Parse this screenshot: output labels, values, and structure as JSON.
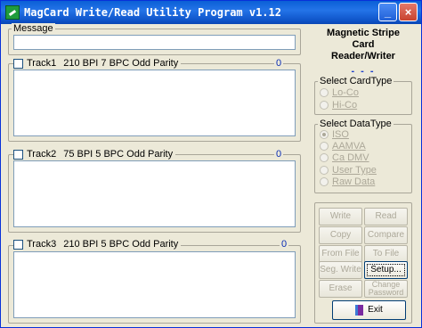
{
  "window": {
    "title": "MagCard Write/Read Utility Program v1.12",
    "minimize": "_",
    "maximize": "□",
    "close": "×"
  },
  "message": {
    "label": "Message",
    "value": ""
  },
  "tracks": [
    {
      "label": "Track1",
      "info": "210 BPI  7 BPC  Odd Parity",
      "count": "0",
      "data": ""
    },
    {
      "label": "Track2",
      "info": "75 BPI  5 BPC  Odd Parity",
      "count": "0",
      "data": ""
    },
    {
      "label": "Track3",
      "info": "210 BPI  5 BPC  Odd Parity",
      "count": "0",
      "data": ""
    }
  ],
  "brand": {
    "line1": "Magnetic Stripe Card",
    "line2": "Reader/Writer",
    "status": "- - -"
  },
  "card_type": {
    "title": "Select CardType",
    "options": [
      "Lo-Co",
      "Hi-Co"
    ]
  },
  "data_type": {
    "title": "Select DataType",
    "options": [
      "ISO",
      "AAMVA",
      "Ca DMV",
      "User Type",
      "Raw Data"
    ],
    "selected": "ISO"
  },
  "buttons": {
    "write": "Write",
    "read": "Read",
    "copy": "Copy",
    "compare": "Compare",
    "from_file": "From File",
    "to_file": "To File",
    "seg_write": "Seg. Write",
    "setup": "Setup...",
    "erase": "Erase",
    "change_password": "Change Password",
    "exit": "Exit"
  }
}
